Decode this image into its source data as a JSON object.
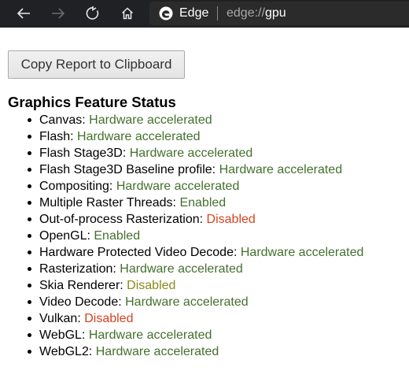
{
  "browser": {
    "site_name": "Edge",
    "url_scheme": "edge://",
    "url_path": "gpu",
    "icons": [
      "back-arrow-icon",
      "forward-arrow-icon",
      "refresh-icon",
      "home-icon",
      "edge-logo-icon"
    ]
  },
  "page": {
    "copy_button_label": "Copy Report to Clipboard",
    "section_title": "Graphics Feature Status",
    "features": [
      {
        "name": "Canvas: ",
        "status": "Hardware accelerated"
      },
      {
        "name": "Flash: ",
        "status": "Hardware accelerated"
      },
      {
        "name": "Flash Stage3D: ",
        "status": "Hardware accelerated"
      },
      {
        "name": "Flash Stage3D Baseline profile: ",
        "status": "Hardware accelerated"
      },
      {
        "name": "Compositing: ",
        "status": "Hardware accelerated"
      },
      {
        "name": "Multiple Raster Threads: ",
        "status": "Enabled"
      },
      {
        "name": "Out-of-process Rasterization: ",
        "status": "Disabled"
      },
      {
        "name": "OpenGL: ",
        "status": "Enabled"
      },
      {
        "name": "Hardware Protected Video Decode: ",
        "status": "Hardware accelerated"
      },
      {
        "name": "Rasterization: ",
        "status": "Hardware accelerated"
      },
      {
        "name": "Skia Renderer: ",
        "status": "Disabled"
      },
      {
        "name": "Video Decode: ",
        "status": "Hardware accelerated"
      },
      {
        "name": "Vulkan: ",
        "status": "Disabled"
      },
      {
        "name": "WebGL: ",
        "status": "Hardware accelerated"
      },
      {
        "name": "WebGL2: ",
        "status": "Hardware accelerated"
      }
    ]
  },
  "colors": {
    "toolbar_bg": "#202124",
    "address_bar_bg": "#2b2b2b",
    "status_green": "#44702e",
    "status_red": "#d7421f",
    "status_olive": "#8b8a1c"
  }
}
